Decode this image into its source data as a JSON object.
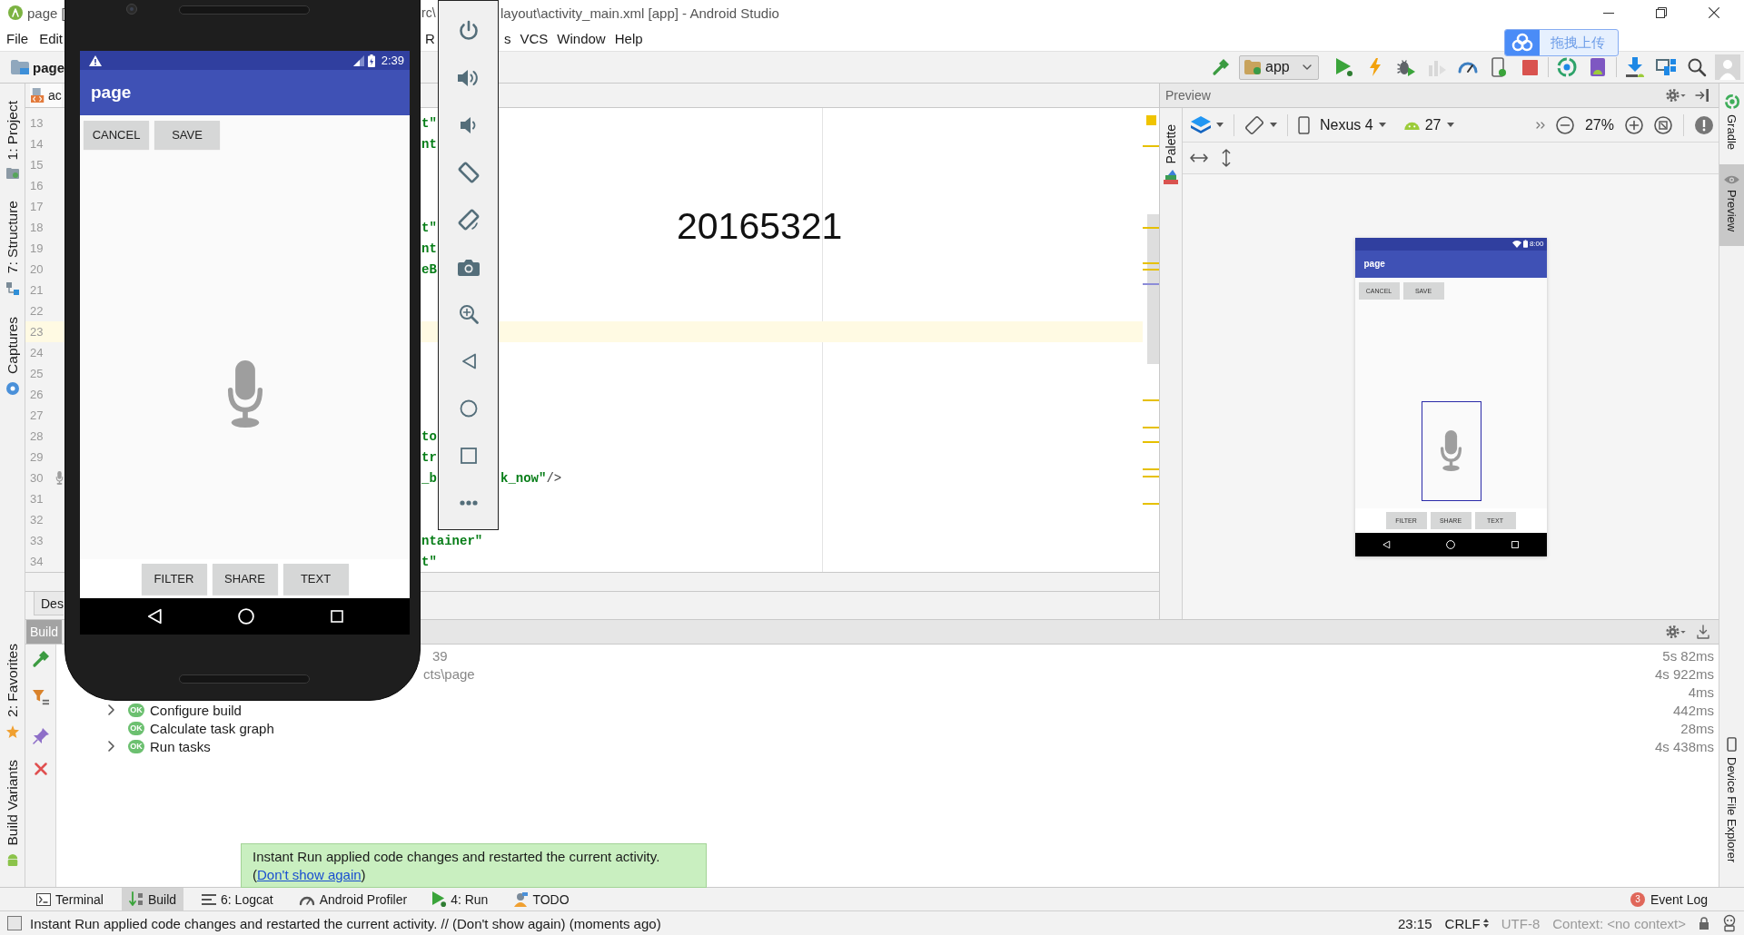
{
  "title_bar": {
    "fragments": [
      "page [",
      "rc\\",
      "layout\\activity_main.xml [app] - Android Studio"
    ]
  },
  "menu_bar": {
    "groups": [
      {
        "items": [
          "File",
          "Edit"
        ]
      },
      {
        "items": [
          "R"
        ]
      },
      {
        "items": [
          "s",
          "VCS",
          "Window",
          "Help"
        ]
      }
    ]
  },
  "main_toolbar": {
    "project": "page",
    "run_config": "app",
    "groups": [
      [
        {
          "kind": "make",
          "disabled": false
        }
      ],
      [
        {
          "kind": "run",
          "disabled": false
        },
        {
          "kind": "apply_changes",
          "disabled": false
        },
        {
          "kind": "debug",
          "disabled": false
        },
        {
          "kind": "coverage",
          "disabled": true
        },
        {
          "kind": "profile",
          "disabled": false
        },
        {
          "kind": "attach_debugger",
          "disabled": false
        },
        {
          "kind": "stop",
          "disabled": false
        }
      ],
      [
        {
          "kind": "sync",
          "disabled": false
        },
        {
          "kind": "avd_manager",
          "disabled": false
        }
      ],
      [
        {
          "kind": "sdk_manager",
          "disabled": false
        },
        {
          "kind": "project_structure",
          "disabled": false
        },
        {
          "kind": "search",
          "disabled": false
        },
        {
          "kind": "account",
          "disabled": false
        }
      ]
    ]
  },
  "baidu_widget": {
    "label": "拖拽上传"
  },
  "emulator": {
    "status_time": "2:39",
    "app_title": "page",
    "top_buttons": [
      "CANCEL",
      "SAVE"
    ],
    "bottom_buttons": [
      "FILTER",
      "SHARE",
      "TEXT"
    ],
    "side_toolbar": [
      {
        "kind": "power"
      },
      {
        "kind": "volume_up"
      },
      {
        "kind": "volume_down"
      },
      {
        "kind": "rotate_left"
      },
      {
        "kind": "rotate_right"
      },
      {
        "kind": "screenshot"
      },
      {
        "kind": "zoom"
      },
      {
        "kind": "back"
      },
      {
        "kind": "home"
      },
      {
        "kind": "overview"
      },
      {
        "kind": "more"
      }
    ]
  },
  "left_stripe": {
    "top": [
      {
        "label": "1: Project",
        "kind": "project"
      },
      {
        "label": "7: Structure",
        "kind": "structure"
      },
      {
        "label": "Captures",
        "kind": "captures"
      }
    ],
    "bottom": [
      {
        "label": "2: Favorites",
        "kind": "favorites"
      },
      {
        "label": "Build Variants",
        "kind": "build_variants"
      }
    ]
  },
  "editor": {
    "tab": "ac",
    "overlay_text": "20165321",
    "lines": [
      {
        "number": "13",
        "current": false,
        "fragments": [
          [
            {
              "text": "t\"",
              "kind": "value"
            }
          ]
        ]
      },
      {
        "number": "14",
        "current": false,
        "fragments": [
          [
            {
              "text": "nt",
              "kind": "value"
            }
          ]
        ]
      },
      {
        "number": "15",
        "current": false
      },
      {
        "number": "16",
        "current": false
      },
      {
        "number": "17",
        "current": false
      },
      {
        "number": "18",
        "current": false,
        "fragments": [
          [
            {
              "text": "t\"",
              "kind": "value"
            }
          ]
        ]
      },
      {
        "number": "19",
        "current": false,
        "fragments": [
          [
            {
              "text": "nt",
              "kind": "value"
            }
          ]
        ]
      },
      {
        "number": "20",
        "current": false,
        "fragments": [
          [
            {
              "text": "eB",
              "kind": "value"
            }
          ]
        ]
      },
      {
        "number": "21",
        "current": false
      },
      {
        "number": "22",
        "current": false
      },
      {
        "number": "23",
        "current": true
      },
      {
        "number": "24",
        "current": false
      },
      {
        "number": "25",
        "current": false
      },
      {
        "number": "26",
        "current": false
      },
      {
        "number": "27",
        "current": false
      },
      {
        "number": "28",
        "current": false,
        "fragments": [
          [
            {
              "text": "to",
              "kind": "value"
            }
          ]
        ]
      },
      {
        "number": "29",
        "current": false,
        "fragments": [
          [
            {
              "text": "tr",
              "kind": "value"
            }
          ]
        ]
      },
      {
        "number": "30",
        "current": false,
        "gutter": {
          "kind": "microphone"
        },
        "fragments": [
          [
            {
              "text": "_b",
              "kind": "value"
            }
          ],
          [
            {
              "text": "k_now\"",
              "kind": "value"
            },
            {
              "text": "/>",
              "kind": "tag"
            }
          ]
        ]
      },
      {
        "number": "31",
        "current": false
      },
      {
        "number": "32",
        "current": false
      },
      {
        "number": "33",
        "current": false,
        "fragments": [
          [
            {
              "text": "ntainer\"",
              "kind": "value"
            }
          ]
        ]
      },
      {
        "number": "34",
        "current": false,
        "fragments": [
          [
            {
              "text": "t\"",
              "kind": "value"
            }
          ]
        ]
      }
    ],
    "error_stripe": {
      "kind": "warning",
      "marks": [
        {
          "kind": "warning"
        },
        {
          "kind": "warning"
        },
        {
          "kind": "warning"
        },
        {
          "kind": "warning"
        },
        {
          "kind": "info"
        },
        {
          "kind": "warning"
        },
        {
          "kind": "warning"
        },
        {
          "kind": "warning"
        },
        {
          "kind": "warning"
        },
        {
          "kind": "warning"
        },
        {
          "kind": "warning"
        }
      ]
    },
    "bottom_tab": "Des"
  },
  "preview": {
    "title": "Preview",
    "palette": "Palette",
    "device": "Nexus 4",
    "api": "27",
    "zoom": "27%",
    "screen": {
      "status_time": "8:00",
      "app_title": "page",
      "top_buttons": [
        "CANCEL",
        "SAVE"
      ],
      "image_selected": true,
      "bottom_buttons": [
        "FILTER",
        "SHARE",
        "TEXT"
      ]
    }
  },
  "right_stripe": {
    "top": [
      {
        "label": "Gradle",
        "kind": "gradle",
        "selected": false
      },
      {
        "label": "Preview",
        "kind": "preview",
        "selected": true
      }
    ],
    "bottom": [
      {
        "label": "Device File Explorer",
        "kind": "device_file_explorer",
        "selected": false
      }
    ]
  },
  "build_panel": {
    "tab": "Build",
    "tree": [
      {
        "label": "39",
        "time": "5s 82ms",
        "children": [
          {
            "label": "cts\\page",
            "time": "4s 922ms",
            "children": [
              {
                "time": "4ms"
              },
              {
                "label": "Configure build",
                "badge": "OK",
                "time": "442ms",
                "expanded": false
              },
              {
                "label": "Calculate task graph",
                "badge": "OK",
                "time": "28ms"
              },
              {
                "label": "Run tasks",
                "badge": "OK",
                "time": "4s 438ms",
                "expanded": false
              }
            ]
          }
        ]
      }
    ]
  },
  "notification": {
    "message": "Instant Run applied code changes and restarted the current activity.",
    "link_prefix": "(",
    "link": "Don't show again",
    "link_suffix": ")"
  },
  "bottom_bar": {
    "tabs": [
      {
        "label": "Terminal",
        "kind": "terminal",
        "selected": false
      },
      {
        "label": "Build",
        "kind": "build",
        "selected": true
      },
      {
        "label": "6: Logcat",
        "kind": "logcat",
        "selected": false
      },
      {
        "label": "Android Profiler",
        "kind": "profiler",
        "selected": false
      },
      {
        "label": "4: Run",
        "kind": "run",
        "selected": false
      },
      {
        "label": "TODO",
        "kind": "todo",
        "selected": false
      }
    ],
    "event_log": {
      "label": "Event Log",
      "count": "3"
    }
  },
  "status_bar": {
    "message": "Instant Run applied code changes and restarted the current activity. // (Don't show again) (moments ago)",
    "items": [
      {
        "text": "23:15",
        "kind": "position",
        "disabled": false
      },
      {
        "text": "CRLF",
        "kind": "line_separator",
        "disabled": false
      },
      {
        "text": "UTF-8",
        "kind": "encoding",
        "disabled": true
      },
      {
        "text": "Context: <no context>",
        "kind": "context",
        "disabled": true
      }
    ]
  }
}
